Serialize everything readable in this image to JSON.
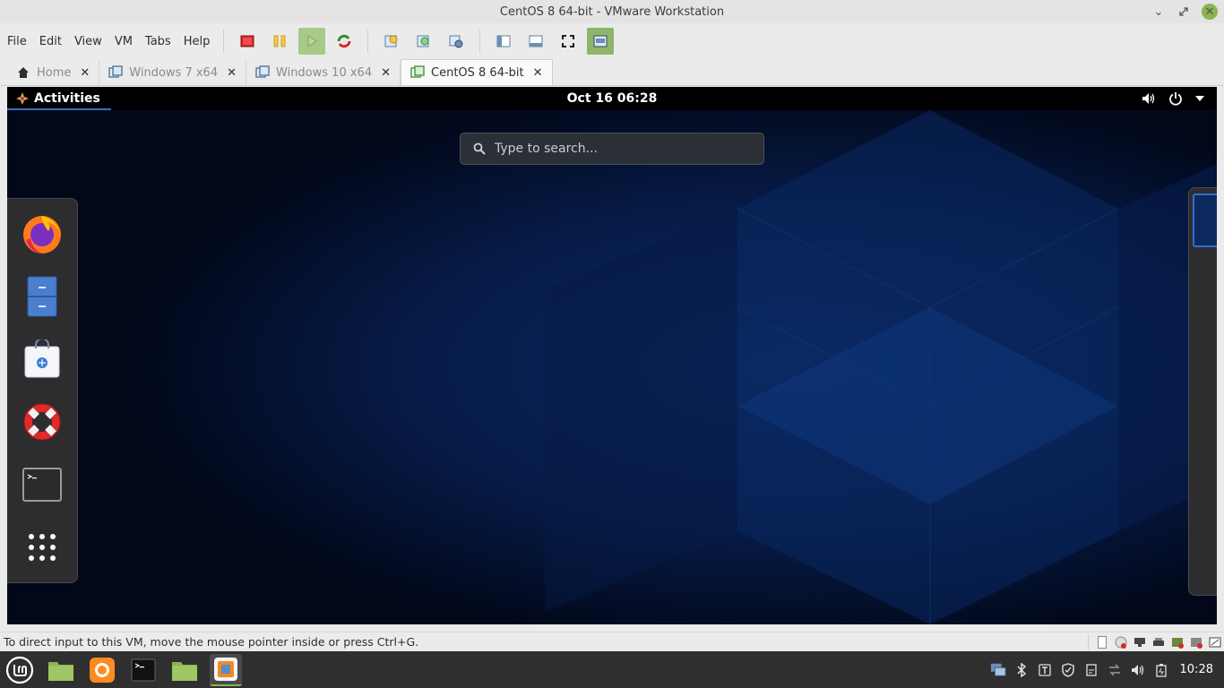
{
  "window": {
    "title": "CentOS 8 64-bit - VMware Workstation"
  },
  "menubar": {
    "items": [
      "File",
      "Edit",
      "View",
      "VM",
      "Tabs",
      "Help"
    ]
  },
  "toolbar": {
    "buttons": [
      "power-off-icon",
      "suspend-icon",
      "power-on-icon",
      "restart-icon",
      "snapshot-icon",
      "revert-snapshot-icon",
      "manage-snapshots-icon",
      "show-library-icon",
      "thumbnail-bar-icon",
      "fullscreen-icon",
      "unity-icon"
    ]
  },
  "tabs": [
    {
      "label": "Home",
      "active": false
    },
    {
      "label": "Windows 7 x64",
      "active": false
    },
    {
      "label": "Windows 10 x64",
      "active": false
    },
    {
      "label": "CentOS 8 64-bit",
      "active": true
    }
  ],
  "guest": {
    "activities_label": "Activities",
    "clock": "Oct 16  06:28",
    "search_placeholder": "Type to search...",
    "dash": [
      "firefox-icon",
      "files-icon",
      "software-icon",
      "help-icon",
      "terminal-icon",
      "show-applications-icon"
    ]
  },
  "statusbar": {
    "message": "To direct input to this VM, move the mouse pointer inside or press Ctrl+G."
  },
  "host_taskbar": {
    "clock": "10:28"
  },
  "colors": {
    "accent_green": "#8ab550",
    "guest_top_bar": "#000000",
    "guest_background": "#030a1c"
  }
}
